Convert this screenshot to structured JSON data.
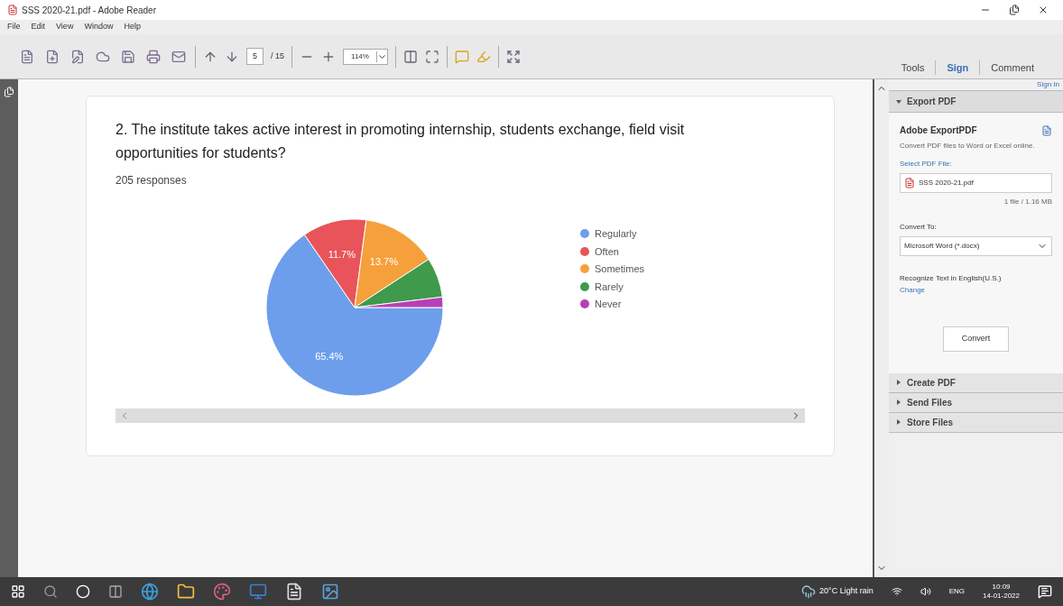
{
  "window": {
    "title": "SSS 2020-21.pdf - Adobe Reader"
  },
  "menu": [
    "File",
    "Edit",
    "View",
    "Window",
    "Help"
  ],
  "toolbar": {
    "page": "5",
    "page_total": "/ 15",
    "zoom": "114%"
  },
  "panel_tabs": [
    {
      "label": "Tools",
      "selected": false
    },
    {
      "label": "Sign",
      "selected": true
    },
    {
      "label": "Comment",
      "selected": false
    }
  ],
  "document": {
    "question": "2. The institute takes active interest in promoting internship, students exchange, field visit opportunities for students?",
    "responses": "205 responses",
    "chart_data": {
      "type": "pie",
      "categories": [
        "Regularly",
        "Often",
        "Sometimes",
        "Rarely",
        "Never"
      ],
      "series": [
        {
          "values": [
            65.4,
            11.7,
            13.7,
            7.3,
            1.9
          ]
        }
      ],
      "colors": [
        "#6d9eeb",
        "#e8545a",
        "#f6a03c",
        "#3f9a4c",
        "#b640b6"
      ],
      "value_labels": [
        "65.4%",
        "11.7%",
        "13.7%",
        null,
        null
      ]
    }
  },
  "side_panel": {
    "sign_in": "Sign In",
    "section": {
      "label": "Export PDF",
      "expanded": true
    },
    "service": "Adobe ExportPDF",
    "description": "Convert PDF files to Word or Excel online.",
    "select_label": "Select PDF File:",
    "file": "SSS 2020-21.pdf",
    "file_info": "1 file / 1.16 MB",
    "convert_to_label": "Convert To:",
    "convert_to": "Microsoft Word (*.docx)",
    "ocr": "Recognize Text in English(U.S.)",
    "change": "Change",
    "convert_button": "Convert",
    "sections": [
      {
        "label": "Create PDF",
        "expanded": false
      },
      {
        "label": "Send Files",
        "expanded": false
      },
      {
        "label": "Store Files",
        "expanded": false
      }
    ]
  },
  "taskbar": {
    "weather": "20°C  Light rain",
    "language": "ENG",
    "time": "10:09",
    "date": "14-01-2022"
  }
}
